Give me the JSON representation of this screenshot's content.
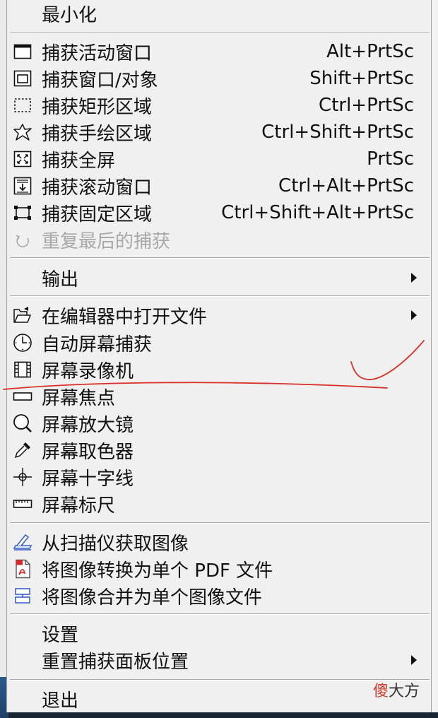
{
  "menu": {
    "minimize": {
      "label": "最小化"
    },
    "capture": [
      {
        "label": "捕获活动窗口",
        "shortcut": "Alt+PrtSc",
        "icon": "window-icon"
      },
      {
        "label": "捕获窗口/对象",
        "shortcut": "Shift+PrtSc",
        "icon": "window-object-icon"
      },
      {
        "label": "捕获矩形区域",
        "shortcut": "Ctrl+PrtSc",
        "icon": "dashed-rectangle-icon"
      },
      {
        "label": "捕获手绘区域",
        "shortcut": "Ctrl+Shift+PrtSc",
        "icon": "freehand-star-icon"
      },
      {
        "label": "捕获全屏",
        "shortcut": "PrtSc",
        "icon": "fullscreen-icon"
      },
      {
        "label": "捕获滚动窗口",
        "shortcut": "Ctrl+Alt+PrtSc",
        "icon": "scroll-window-icon"
      },
      {
        "label": "捕获固定区域",
        "shortcut": "Ctrl+Shift+Alt+PrtSc",
        "icon": "fixed-region-icon"
      }
    ],
    "repeat_last": {
      "label": "重复最后的捕获",
      "disabled": true
    },
    "output": {
      "label": "输出"
    },
    "tools": [
      {
        "label": "在编辑器中打开文件",
        "icon": "open-folder-icon",
        "submenu": true
      },
      {
        "label": "自动屏幕捕获",
        "icon": "clock-icon"
      },
      {
        "label": "屏幕录像机",
        "icon": "film-icon"
      },
      {
        "label": "屏幕焦点",
        "icon": "focus-bar-icon"
      },
      {
        "label": "屏幕放大镜",
        "icon": "magnifier-icon"
      },
      {
        "label": "屏幕取色器",
        "icon": "eyedropper-icon"
      },
      {
        "label": "屏幕十字线",
        "icon": "crosshair-icon"
      },
      {
        "label": "屏幕标尺",
        "icon": "ruler-icon"
      }
    ],
    "image_tools": [
      {
        "label": "从扫描仪获取图像",
        "icon": "scanner-icon"
      },
      {
        "label": "将图像转换为单个 PDF 文件",
        "icon": "pdf-icon"
      },
      {
        "label": "将图像合并为单个图像文件",
        "icon": "merge-images-icon"
      }
    ],
    "settings": {
      "label": "设置"
    },
    "reset_panel": {
      "label": "重置捕获面板位置"
    },
    "exit": {
      "label": "退出"
    }
  },
  "watermark": {
    "part1": "傻",
    "part2": "大方"
  },
  "colors": {
    "menu_bg": "#f0f0f0",
    "separator": "#a9a9a9",
    "disabled_text": "#a8a8a8",
    "annotation": "#d93025",
    "icon_blue": "#3a5fc8",
    "pdf_red": "#d8262b"
  }
}
